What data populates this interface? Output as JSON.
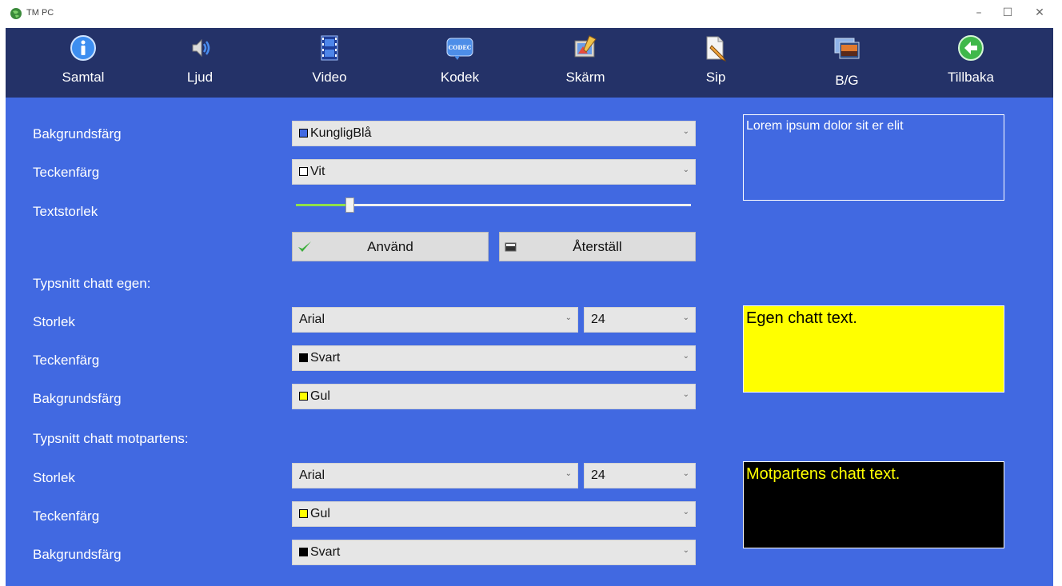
{
  "window": {
    "title": "TM PC",
    "minimize_glyph": "–",
    "maximize_glyph": "☐",
    "close_glyph": "✕"
  },
  "toolbar": {
    "items": [
      {
        "label": "Samtal",
        "icon": "info-icon"
      },
      {
        "label": "Ljud",
        "icon": "speaker-icon"
      },
      {
        "label": "Video",
        "icon": "film-icon"
      },
      {
        "label": "Kodek",
        "icon": "codec-icon",
        "icon_text": "CODEC"
      },
      {
        "label": "Skärm",
        "icon": "screen-paint-icon"
      },
      {
        "label": "Sip",
        "icon": "document-pencil-icon"
      },
      {
        "label": "B/G",
        "icon": "background-image-icon"
      },
      {
        "label": "Tillbaka",
        "icon": "back-arrow-icon"
      }
    ]
  },
  "colors": {
    "toolbar_bg": "#243268",
    "main_bg": "#4169e1",
    "royal_blue": "#4169e1",
    "white": "#ffffff",
    "black": "#000000",
    "yellow": "#ffff00"
  },
  "general": {
    "bg_color_label": "Bakgrundsfärg",
    "bg_color_value": "KungligBlå",
    "text_color_label": "Teckenfärg",
    "text_color_value": "Vit",
    "text_size_label": "Textstorlek",
    "text_size_fraction": 0.135,
    "apply_label": "Använd",
    "reset_label": "Återställ",
    "preview_text": "Lorem ipsum dolor sit er elit"
  },
  "own_chat": {
    "heading": "Typsnitt chatt egen:",
    "size_label": "Storlek",
    "font_value": "Arial",
    "size_value": "24",
    "text_color_label": "Teckenfärg",
    "text_color_value": "Svart",
    "bg_color_label": "Bakgrundsfärg",
    "bg_color_value": "Gul",
    "preview_text": "Egen chatt text."
  },
  "remote_chat": {
    "heading": "Typsnitt chatt motpartens:",
    "size_label": "Storlek",
    "font_value": "Arial",
    "size_value": "24",
    "text_color_label": "Teckenfärg",
    "text_color_value": "Gul",
    "bg_color_label": "Bakgrundsfärg",
    "bg_color_value": "Svart",
    "preview_text": "Motpartens chatt text."
  }
}
